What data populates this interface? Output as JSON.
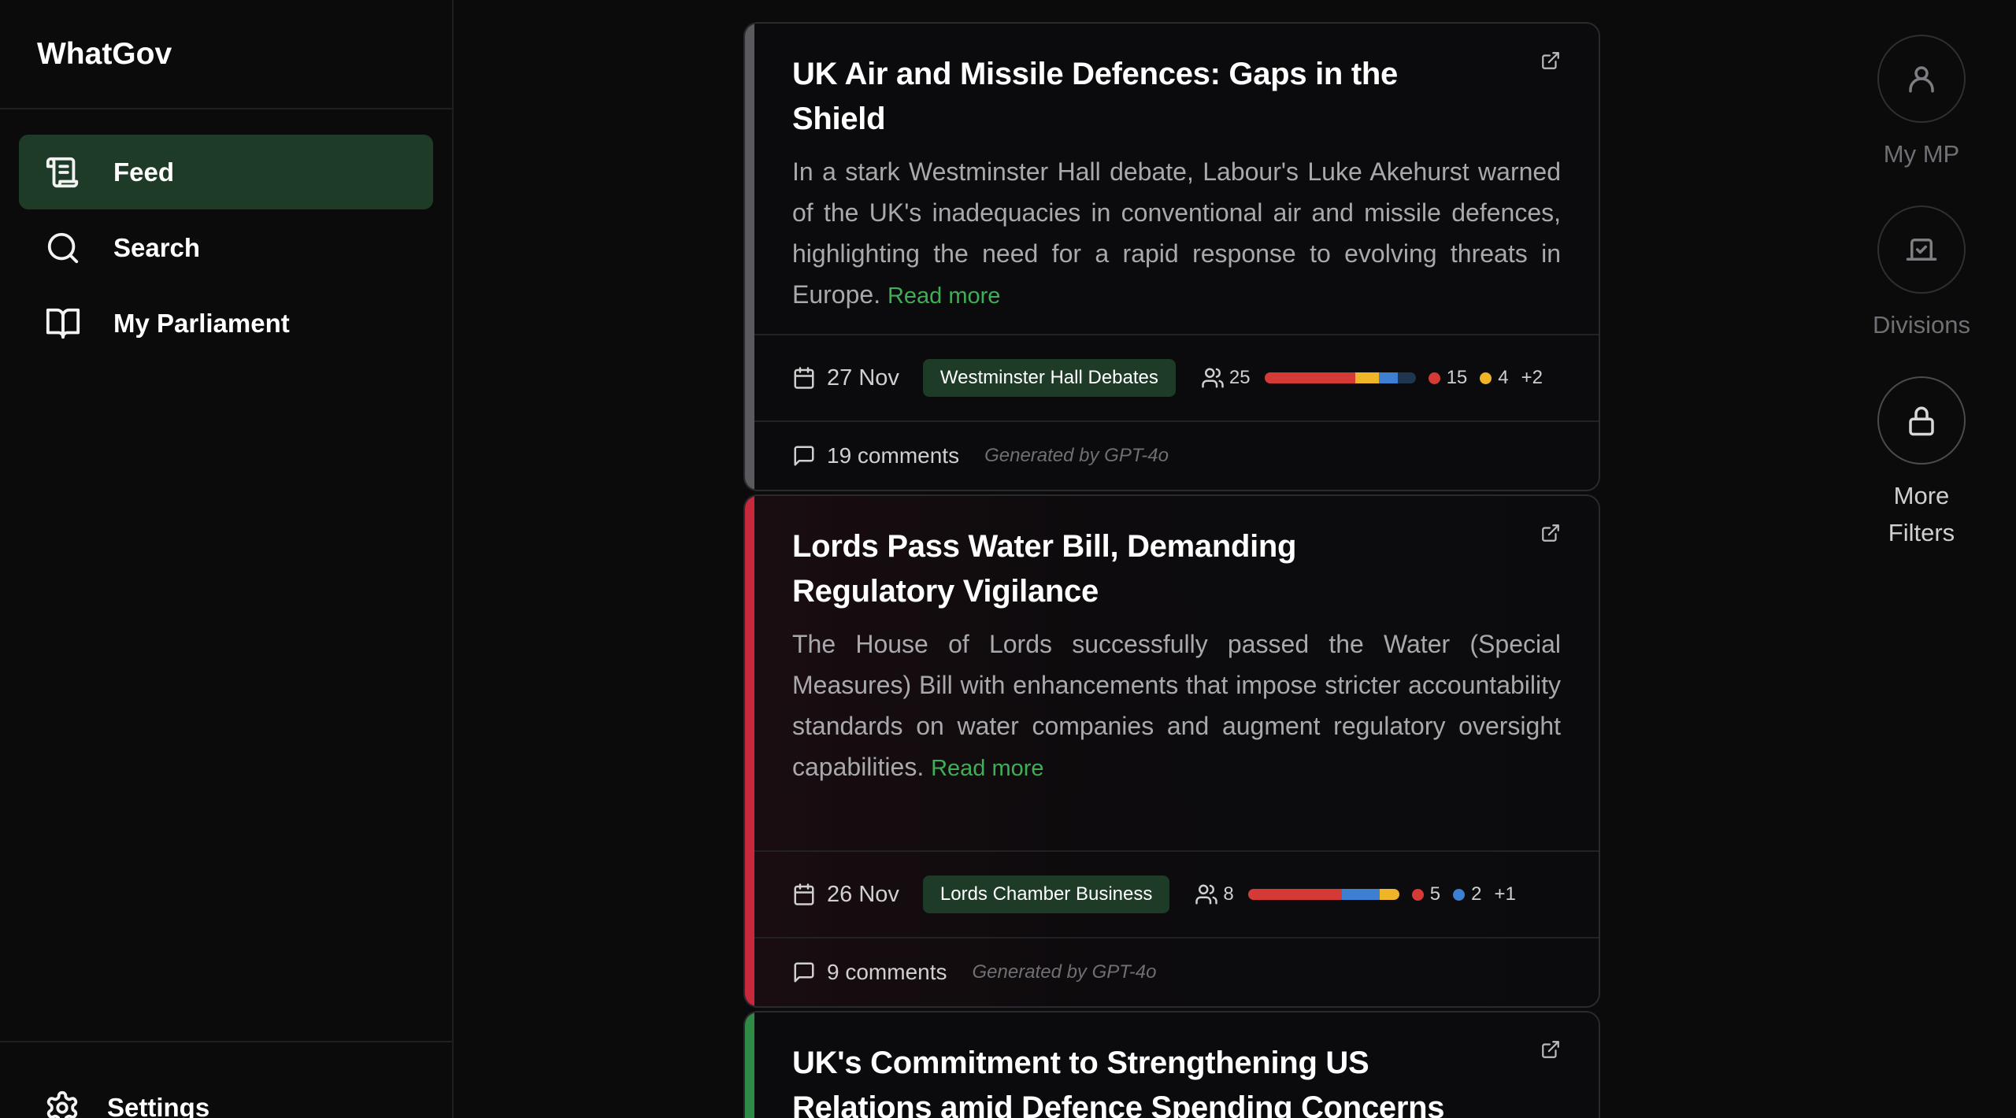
{
  "app": {
    "brand": "WhatGov"
  },
  "sidebar": {
    "items": [
      {
        "label": "Feed",
        "icon": "scroll-icon",
        "active": true
      },
      {
        "label": "Search",
        "icon": "search-icon",
        "active": false
      },
      {
        "label": "My Parliament",
        "icon": "book-open-icon",
        "active": false
      }
    ],
    "settings_label": "Settings"
  },
  "feed": {
    "read_more_label": "Read more",
    "cards": [
      {
        "title": "UK Air and Missile Defences: Gaps in the Shield",
        "summary": "In a stark Westminster Hall debate, Labour's Luke Akehurst warned of the UK's inadequacies in conventional air and missile defences, highlighting the need for a rapid response to evolving threats in Europe.",
        "date": "27 Nov",
        "badge": "Westminster Hall Debates",
        "speakers": "25",
        "party_counts": [
          {
            "count": "15",
            "color": "#d63a36"
          },
          {
            "count": "4",
            "color": "#f0b429"
          }
        ],
        "more": "+2",
        "party_bar": [
          {
            "share": 0.6,
            "color": "#d63a36"
          },
          {
            "share": 0.16,
            "color": "#f0b429"
          },
          {
            "share": 0.12,
            "color": "#3d7fd1"
          },
          {
            "share": 0.12,
            "color": "#1f3550"
          }
        ],
        "comments": "19 comments",
        "generated": "Generated by GPT-4o",
        "accent": "#5a5a5e"
      },
      {
        "title": "Lords Pass Water Bill, Demanding Regulatory Vigilance",
        "summary": "The House of Lords successfully passed the Water (Special Measures) Bill with enhancements that impose stricter accountability standards on water companies and augment regulatory oversight capabilities.",
        "date": "26 Nov",
        "badge": "Lords Chamber Business",
        "speakers": "8",
        "party_counts": [
          {
            "count": "5",
            "color": "#d63a36"
          },
          {
            "count": "2",
            "color": "#3d7fd1"
          }
        ],
        "more": "+1",
        "party_bar": [
          {
            "share": 0.62,
            "color": "#d63a36"
          },
          {
            "share": 0.25,
            "color": "#3d7fd1"
          },
          {
            "share": 0.13,
            "color": "#f0b429"
          }
        ],
        "comments": "9 comments",
        "generated": "Generated by GPT-4o",
        "accent": "#c8283b"
      },
      {
        "title": "UK's Commitment to Strengthening US Relations amid Defence Spending Concerns",
        "accent": "#2f8a45"
      }
    ]
  },
  "filters": [
    {
      "label": "My MP",
      "icon": "user-icon"
    },
    {
      "label": "Divisions",
      "icon": "vote-box-icon"
    },
    {
      "label": "More Filters",
      "icon": "lock-icon"
    }
  ]
}
